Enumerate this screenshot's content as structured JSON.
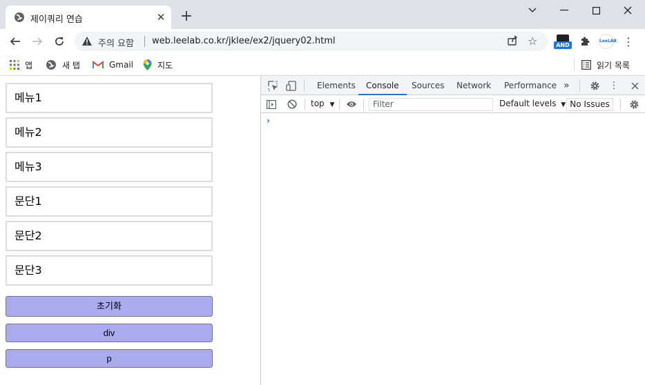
{
  "browser": {
    "tab_title": "제이쿼리 연습",
    "address": {
      "security_label": "주의 요함",
      "url": "web.leelab.co.kr/jklee/ex2/jquery02.html"
    },
    "extensions": {
      "and_badge": "AND",
      "leelab_label": "LeeLAB"
    },
    "bookmarks": [
      {
        "label": "앱",
        "icon": "apps-grid-icon"
      },
      {
        "label": "새 탭",
        "icon": "globe-icon"
      },
      {
        "label": "Gmail",
        "icon": "gmail-icon"
      },
      {
        "label": "지도",
        "icon": "maps-pin-icon"
      }
    ],
    "reading_list": "읽기 목록"
  },
  "page": {
    "boxes": [
      {
        "label": "메뉴1"
      },
      {
        "label": "메뉴2"
      },
      {
        "label": "메뉴3"
      },
      {
        "label": "문단1"
      },
      {
        "label": "문단2"
      },
      {
        "label": "문단3"
      }
    ],
    "buttons": [
      {
        "label": "초기화"
      },
      {
        "label": "div"
      },
      {
        "label": "p"
      }
    ]
  },
  "devtools": {
    "tabs": [
      "Elements",
      "Console",
      "Sources",
      "Network",
      "Performance"
    ],
    "active_tab": "Console",
    "more_tabs": "»",
    "console": {
      "context": "top",
      "filter_placeholder": "Filter",
      "levels": "Default levels",
      "issues": "No Issues",
      "prompt": "›"
    }
  },
  "colors": {
    "tabstrip": "#dee1e6",
    "button_bg": "#aaaaee",
    "box_border": "#dcdcdc",
    "accent": "#1a73e8"
  }
}
